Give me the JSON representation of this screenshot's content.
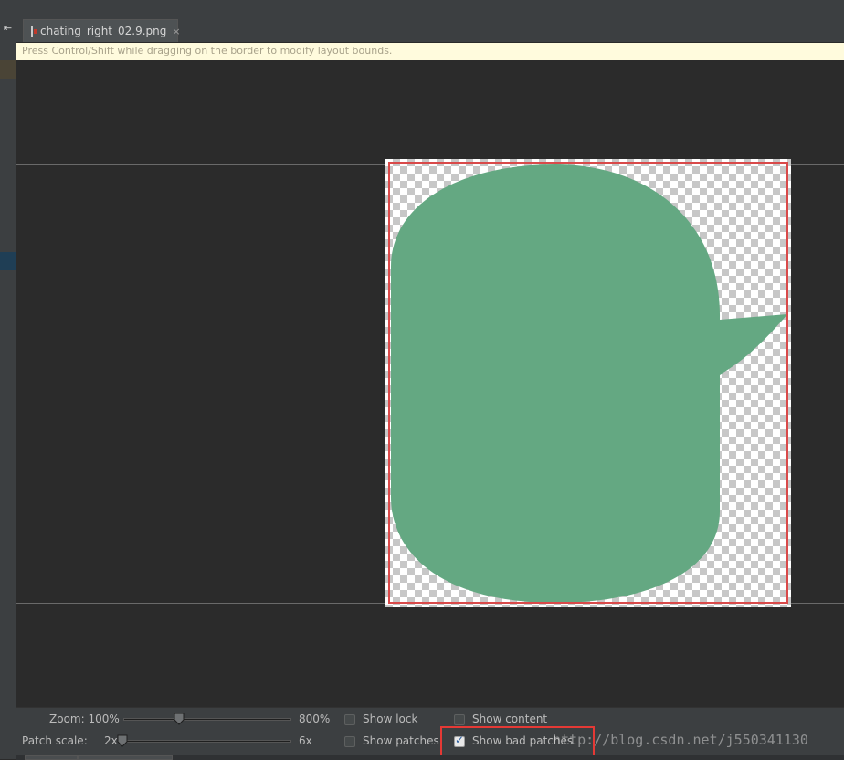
{
  "tab": {
    "file_name": "chating_right_02.9.png",
    "close_glyph": "×",
    "icon": "image-file-icon"
  },
  "hint": {
    "text": "Press Control/Shift while dragging on the border to modify layout bounds."
  },
  "nav": {
    "back_glyph": "⇤"
  },
  "controls": {
    "zoom": {
      "label": "Zoom: 100%",
      "max_label": "800%",
      "value_percent": 100,
      "min_percent": 100,
      "max_percent": 800
    },
    "patch_scale": {
      "label": "Patch scale:",
      "min_label": "2x",
      "max_label": "6x",
      "value": 2,
      "min": 2,
      "max": 6
    },
    "checkboxes": [
      {
        "id": "show_lock",
        "label": "Show lock",
        "checked": false
      },
      {
        "id": "show_content",
        "label": "Show content",
        "checked": false
      },
      {
        "id": "show_patches",
        "label": "Show patches",
        "checked": false
      },
      {
        "id": "show_bad_patches",
        "label": "Show bad patches",
        "checked": true
      }
    ]
  },
  "watermark": {
    "text": "http://blog.csdn.net/j550341130"
  },
  "colors": {
    "bubble": "#64a882",
    "bad_patch_border": "#d94a4a",
    "highlight": "#e53935"
  }
}
